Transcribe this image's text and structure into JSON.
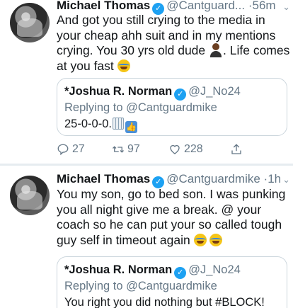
{
  "tweets": [
    {
      "author": "Michael Thomas",
      "handle": "@Cantguard...",
      "time": "56m",
      "separator": "·",
      "text_parts": [
        "And got you still crying to the media in your cheap ahh suit and in my mentions crying. You 30 yrs old dude ",
        ". Life comes at you fast "
      ],
      "quote": {
        "author": "*Joshua R. Norman",
        "handle": "@J_No24",
        "replying_to": "Replying to @Cantguardmike",
        "text": "25-0-0-0."
      },
      "actions": {
        "replies": "27",
        "retweets": "97",
        "likes": "228"
      }
    },
    {
      "author": "Michael Thomas",
      "handle": "@Cantguardmike",
      "time": "1h",
      "separator": "·",
      "text": "You my son, go to bed son. I was punking you all night give me a break. @ your coach so he can put your so called tough guy self in timeout again ",
      "quote": {
        "author": "*Joshua R. Norman",
        "handle": "@J_No24",
        "replying_to": "Replying to @Cantguardmike",
        "text": "You right you did nothing but #BLOCK!"
      }
    }
  ],
  "icons": {
    "verified": "verified-badge-icon",
    "chevron": "chevron-down-icon",
    "reply": "reply-icon",
    "retweet": "retweet-icon",
    "like": "heart-icon",
    "share": "share-icon"
  },
  "colors": {
    "accent": "#1da1f2",
    "muted": "#657786",
    "border": "#ccd6dd"
  }
}
